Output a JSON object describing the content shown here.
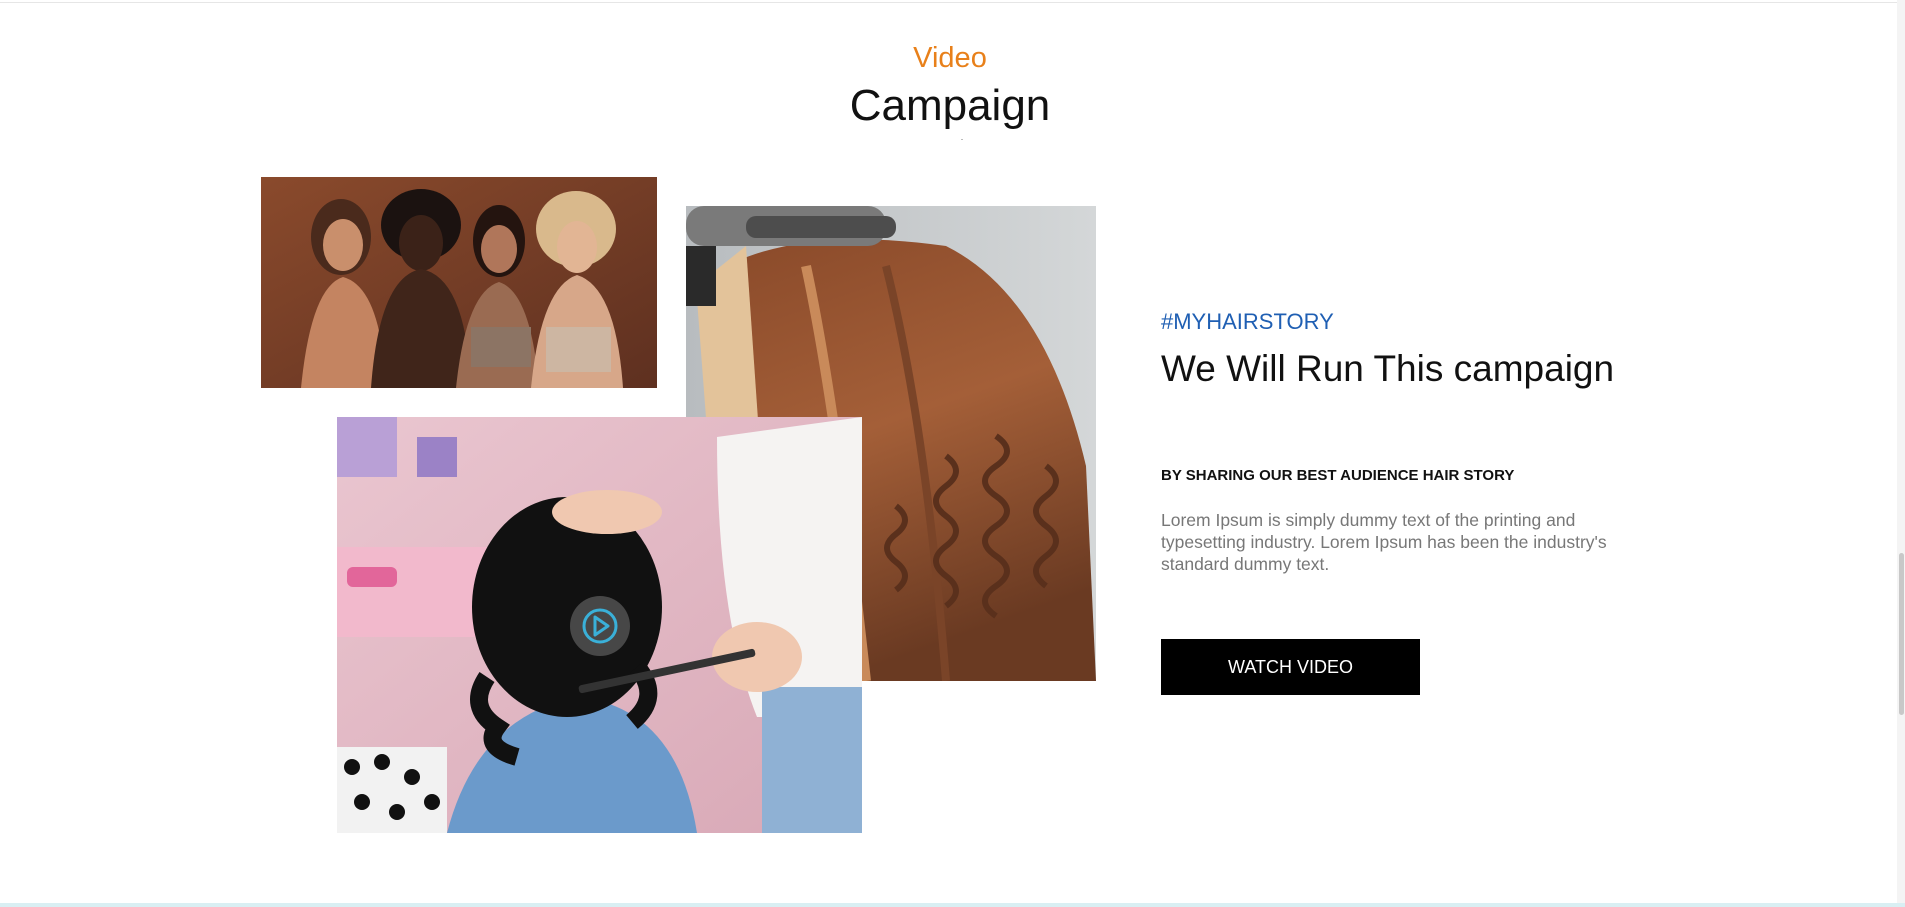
{
  "section": {
    "eyebrow": "Video",
    "title": "Campaign"
  },
  "images": {
    "group": "group-portrait-photo",
    "curling": "hair-curling-photo",
    "haircut": "haircut-video-thumbnail"
  },
  "campaign": {
    "hashtag": "#MYHAIRSTORY",
    "headline": "We Will Run This campaign",
    "subhead": "BY SHARING OUR BEST AUDIENCE HAIR STORY",
    "body": "Lorem Ipsum is simply dummy text of the printing and typesetting industry. Lorem Ipsum has been the industry's standard dummy text.",
    "button_label": "WATCH VIDEO"
  },
  "icons": {
    "play": "play-icon"
  },
  "colors": {
    "eyebrow": "#e8801a",
    "hashtag": "#1f5fb3",
    "button_bg": "#000000",
    "play_icon": "#3ab0d8"
  }
}
